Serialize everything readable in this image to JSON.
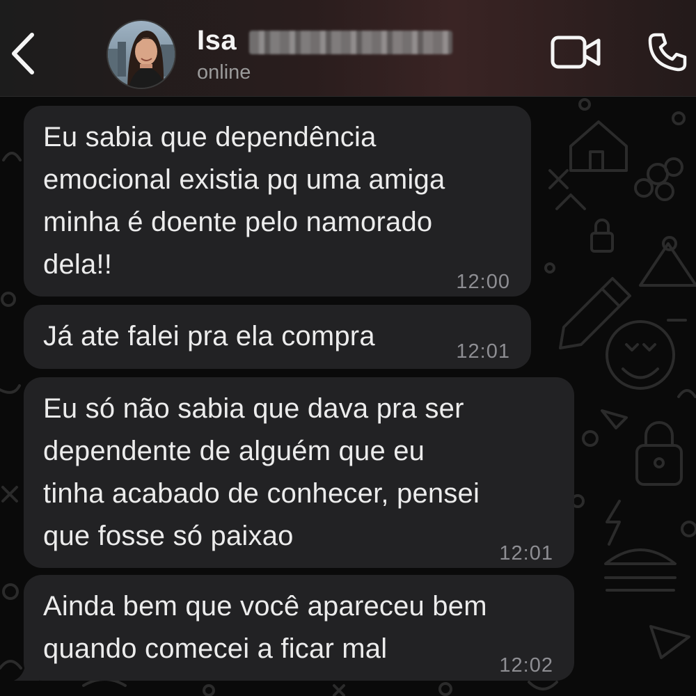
{
  "header": {
    "back_icon": "chevron-left-icon",
    "contact_name": "Isa",
    "contact_status": "online",
    "video_icon": "video-camera-icon",
    "call_icon": "phone-icon"
  },
  "messages": [
    {
      "text": "Eu sabia que dependência\nemocional existia pq uma amiga\nminha é doente pelo namorado\ndela!!",
      "time": "12:00"
    },
    {
      "text": "Já ate falei pra ela compra",
      "time": "12:01"
    },
    {
      "text": "Eu só não sabia que dava pra ser\ndependente de alguém que eu\ntinha acabado de conhecer, pensei\nque fosse só paixao",
      "time": "12:01"
    },
    {
      "text": "Ainda bem que você apareceu bem\nquando comecei a ficar mal",
      "time": "12:02"
    }
  ],
  "colors": {
    "bubble": "#222224",
    "background": "#0a0a0a",
    "text": "#ececec",
    "timestamp": "#8e8e93"
  }
}
